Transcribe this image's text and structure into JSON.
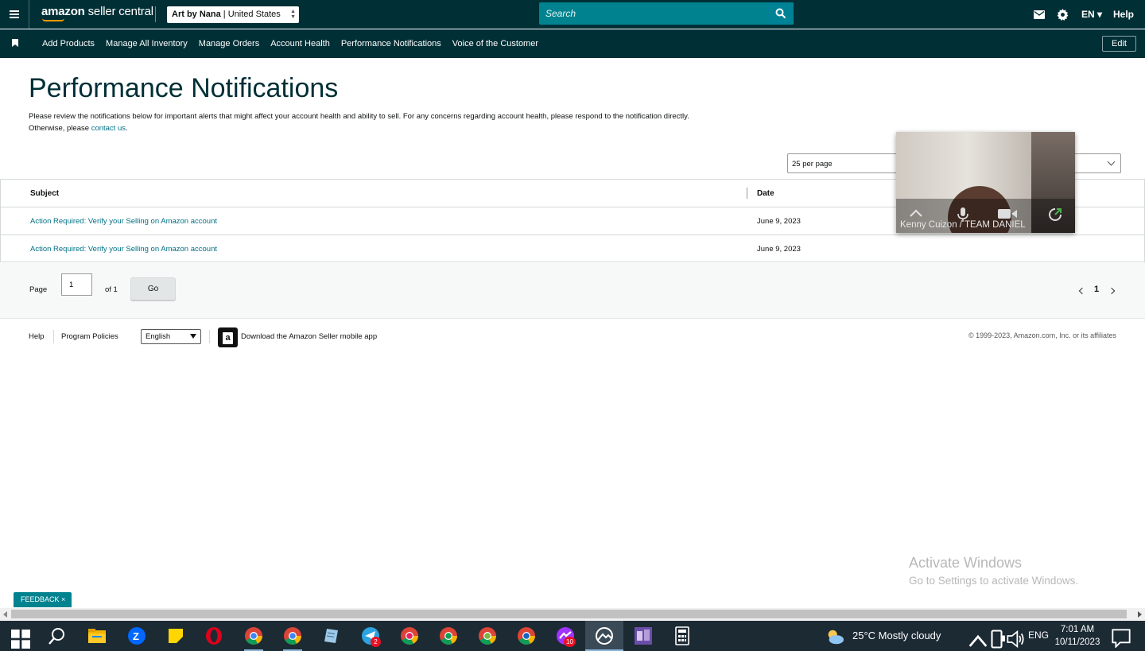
{
  "topbar": {
    "logo_brand": "amazon",
    "logo_product": " seller central",
    "account_store": "Art by Nana",
    "account_sep": " | ",
    "account_market": "United States",
    "search_placeholder": "Search",
    "lang": "EN",
    "help": "Help"
  },
  "navbar": {
    "items": [
      "Add Products",
      "Manage All Inventory",
      "Manage Orders",
      "Account Health",
      "Performance Notifications",
      "Voice of the Customer"
    ],
    "edit": "Edit"
  },
  "page": {
    "title": "Performance Notifications",
    "intro_line1": "Please review the notifications below for important alerts that might affect your account health and ability to sell. For any concerns regarding account health, please respond to the notification directly.",
    "intro_line2_prefix": "Otherwise, please ",
    "intro_link": "contact us",
    "intro_line2_suffix": ".",
    "per_page": "25 per page"
  },
  "table": {
    "headers": {
      "subject": "Subject",
      "date": "Date"
    },
    "rows": [
      {
        "subject": "Action Required: Verify your Selling on Amazon account",
        "date": "June 9, 2023"
      },
      {
        "subject": "Action Required: Verify your Selling on Amazon account",
        "date": "June 9, 2023"
      }
    ]
  },
  "pager": {
    "page_label": "Page",
    "page_value": "1",
    "of_label": "of 1",
    "go": "Go",
    "current": "1"
  },
  "footer": {
    "help": "Help",
    "policies": "Program Policies",
    "language": "English",
    "app_text": "Download the Amazon Seller mobile app",
    "app_icon_letter": "a",
    "copyright": "© 1999-2023, Amazon.com, Inc. or its affiliates"
  },
  "video_call": {
    "caller": "Kenny Cuizon / TEAM DANIEL"
  },
  "overlay": {
    "activate_title": "Activate Windows",
    "activate_sub": "Go to Settings to activate Windows.",
    "feedback": "FEEDBACK ×"
  },
  "taskbar": {
    "weather": "25°C  Mostly cloudy",
    "lang": "ENG",
    "time": "7:01 AM",
    "date": "10/11/2023",
    "badges": {
      "telegram": "2",
      "messenger": "10"
    }
  },
  "colors": {
    "header_bg": "#002f36",
    "search_bg": "#00838f",
    "link": "#007185"
  }
}
